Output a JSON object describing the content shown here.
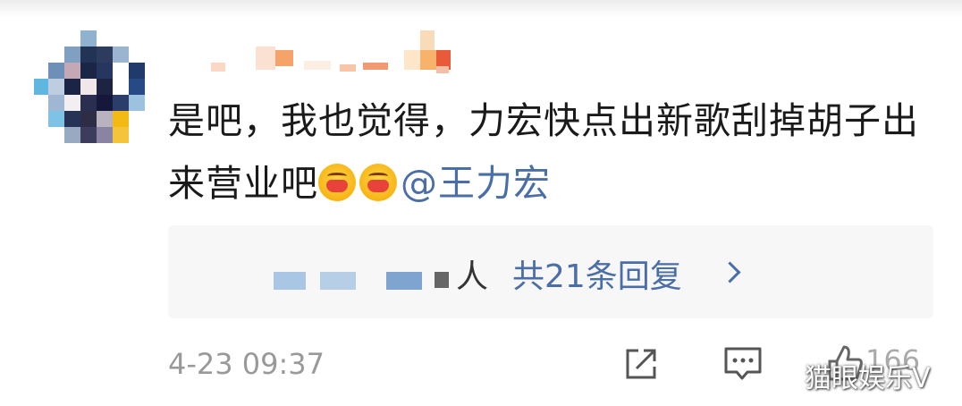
{
  "comment": {
    "text": "是吧，我也觉得，力宏快点出新歌刮掉胡子出来营业吧",
    "emojis": [
      "hug-emoji",
      "hug-emoji"
    ],
    "mention": "@王力宏"
  },
  "replies": {
    "suffix": "人",
    "link_label": "共21条回复"
  },
  "footer": {
    "timestamp": "4-23 09:37",
    "like_count": "166",
    "icons": [
      "share-icon",
      "comment-icon",
      "like-icon"
    ]
  },
  "watermark": "猫眼娱乐V",
  "colors": {
    "link": "#4a6ea8",
    "text": "#1a1a1a",
    "muted": "#999999",
    "reply_bg": "#f7f7f7"
  }
}
